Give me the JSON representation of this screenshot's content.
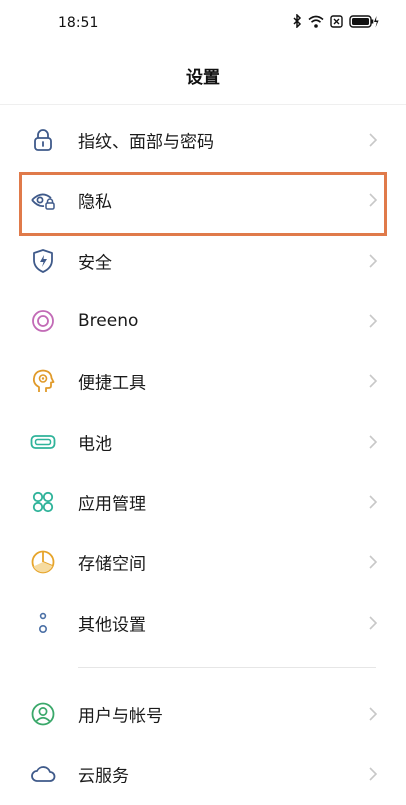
{
  "status_bar": {
    "time": "18:51",
    "icons": [
      "bluetooth-icon",
      "wifi-icon",
      "sim-off-icon",
      "battery-charging-icon"
    ]
  },
  "header": {
    "title": "设置"
  },
  "menu": {
    "items": [
      {
        "id": "fingerprint",
        "label": "指纹、面部与密码",
        "icon": "lock-icon",
        "color": "#3f5a8a"
      },
      {
        "id": "privacy",
        "label": "隐私",
        "icon": "privacy-eye-lock-icon",
        "color": "#3f5a8a",
        "highlighted": true
      },
      {
        "id": "security",
        "label": "安全",
        "icon": "shield-bolt-icon",
        "color": "#3f5a8a"
      },
      {
        "id": "breeno",
        "label": "Breeno",
        "icon": "breeno-ring-icon",
        "color": "#c26ab6"
      },
      {
        "id": "shortcuts",
        "label": "便捷工具",
        "icon": "assistant-head-icon",
        "color": "#e09a2a"
      },
      {
        "id": "battery",
        "label": "电池",
        "icon": "battery-icon",
        "color": "#2fb39a"
      },
      {
        "id": "apps",
        "label": "应用管理",
        "icon": "apps-grid-icon",
        "color": "#2fb39a"
      },
      {
        "id": "storage",
        "label": "存储空间",
        "icon": "storage-pie-icon",
        "color": "#e6a42a"
      },
      {
        "id": "other",
        "label": "其他设置",
        "icon": "other-settings-icon",
        "color": "#4a6fa5"
      }
    ],
    "items2": [
      {
        "id": "account",
        "label": "用户与帐号",
        "icon": "user-account-icon",
        "color": "#3aa86a"
      },
      {
        "id": "cloud",
        "label": "云服务",
        "icon": "cloud-icon",
        "color": "#3f5a8a"
      }
    ]
  },
  "highlight_color": "#e07a4a"
}
